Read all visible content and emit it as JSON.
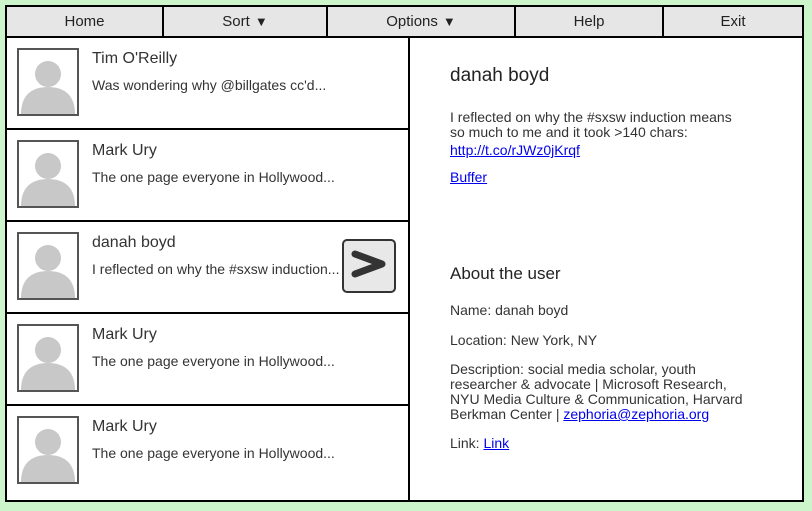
{
  "menu": {
    "home": "Home",
    "sort": "Sort",
    "options": "Options",
    "help": "Help",
    "exit": "Exit",
    "dropdown_glyph": "▼"
  },
  "list": {
    "items": [
      {
        "name": "Tim O'Reilly",
        "text": "Was wondering why @billgates cc'd..."
      },
      {
        "name": "Mark Ury",
        "text": "The one page everyone in Hollywood..."
      },
      {
        "name": "danah boyd",
        "text": "I reflected on why the #sxsw induction..."
      },
      {
        "name": "Mark Ury",
        "text": "The one page everyone in Hollywood..."
      },
      {
        "name": "Mark Ury",
        "text": "The one page everyone in Hollywood..."
      }
    ],
    "selected_index": 2,
    "open_button_icon": "chevron-right-icon"
  },
  "detail": {
    "name": "danah boyd",
    "tweet": "I reflected on why the #sxsw induction means so much to me and it took >140 chars:",
    "url": "http://t.co/rJWz0jKrqf",
    "buffer": "Buffer",
    "about_heading": "About the user",
    "name_label": "Name:",
    "name_value": "danah boyd",
    "location_label": "Location:",
    "location_value": "New York, NY",
    "description_label": "Description:",
    "description_value": "social media scholar, youth researcher & advocate | Microsoft Research, NYU Media Culture & Communication, Harvard Berkman Center |",
    "description_link": "zephoria@zephoria.org",
    "link_label": "Link:",
    "link_value": "Link"
  },
  "colors": {
    "background": "#ccf5cc",
    "menu_bg": "#e6e6e6",
    "link": "#0000ee",
    "avatar_silhouette": "#c8c8c8"
  }
}
